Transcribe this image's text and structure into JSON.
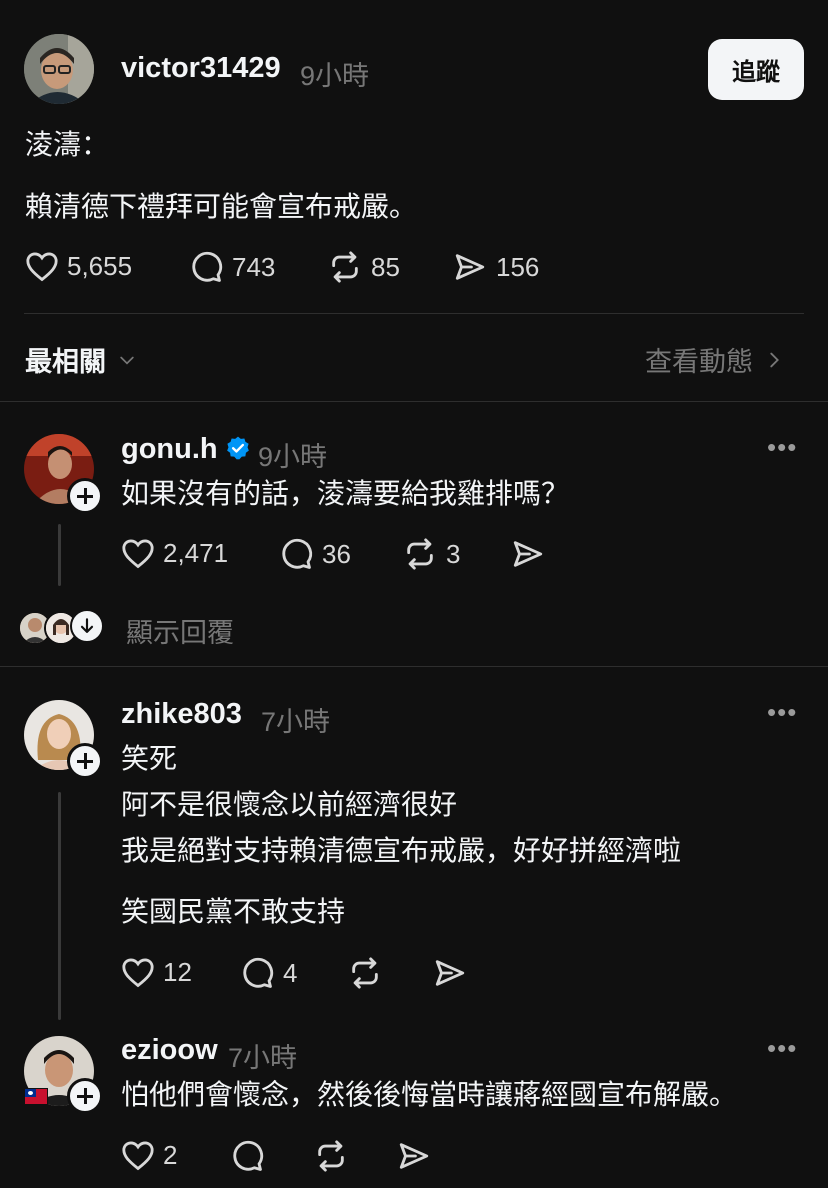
{
  "post": {
    "username": "victor31429",
    "time": "9小時",
    "follow_label": "追蹤",
    "lines": [
      "淩濤：",
      "賴清德下禮拜可能會宣布戒嚴。"
    ],
    "likes": "5,655",
    "comments": "743",
    "reposts": "85",
    "shares": "156"
  },
  "sort_bar": {
    "label": "最相關",
    "activity_label": "查看動態"
  },
  "replies": [
    {
      "username": "gonu.h",
      "verified": true,
      "time": "9小時",
      "lines": [
        "如果沒有的話，淩濤要給我雞排嗎？"
      ],
      "likes": "2,471",
      "comments": "36",
      "reposts": "3",
      "show_replies_label": "顯示回覆"
    },
    {
      "username": "zhike803",
      "time": "7小時",
      "lines": [
        "笑死",
        "阿不是很懷念以前經濟很好",
        "我是絕對支持賴清德宣布戒嚴，好好拼經濟啦",
        "笑國民黨不敢支持"
      ],
      "likes": "12",
      "comments": "4"
    },
    {
      "username": "ezioow",
      "time": "7小時",
      "lines": [
        "怕他們會懷念，然後後悔當時讓蔣經國宣布解嚴。"
      ],
      "likes": "2"
    }
  ],
  "colors": {
    "background": "#101010",
    "text": "#f3f5f7",
    "muted": "#777777",
    "verified": "#0095f6"
  }
}
